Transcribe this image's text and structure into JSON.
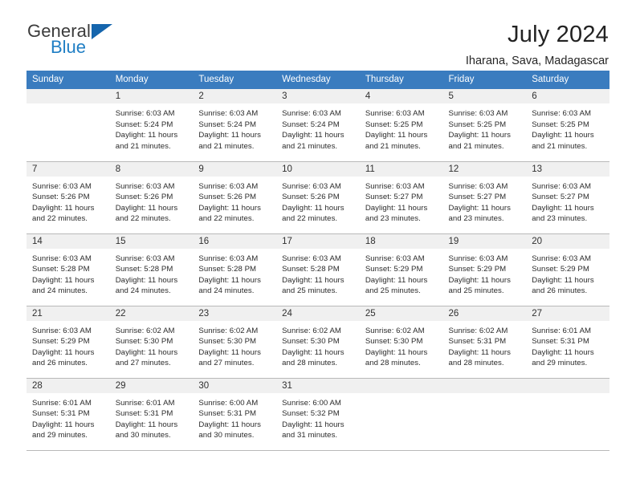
{
  "brand": {
    "name_part1": "General",
    "name_part2": "Blue",
    "logo_icon": "triangle-flag-icon",
    "accent_color": "#1565ad",
    "blue_text_color": "#1f7ec4"
  },
  "header": {
    "title": "July 2024",
    "location": "Iharana, Sava, Madagascar"
  },
  "calendar": {
    "header_bg": "#3a7cbf",
    "daynum_bg": "#f0f0f0",
    "weekdays": [
      "Sunday",
      "Monday",
      "Tuesday",
      "Wednesday",
      "Thursday",
      "Friday",
      "Saturday"
    ],
    "weeks": [
      [
        {
          "day": "",
          "lines": []
        },
        {
          "day": "1",
          "lines": [
            "Sunrise: 6:03 AM",
            "Sunset: 5:24 PM",
            "Daylight: 11 hours",
            "and 21 minutes."
          ]
        },
        {
          "day": "2",
          "lines": [
            "Sunrise: 6:03 AM",
            "Sunset: 5:24 PM",
            "Daylight: 11 hours",
            "and 21 minutes."
          ]
        },
        {
          "day": "3",
          "lines": [
            "Sunrise: 6:03 AM",
            "Sunset: 5:24 PM",
            "Daylight: 11 hours",
            "and 21 minutes."
          ]
        },
        {
          "day": "4",
          "lines": [
            "Sunrise: 6:03 AM",
            "Sunset: 5:25 PM",
            "Daylight: 11 hours",
            "and 21 minutes."
          ]
        },
        {
          "day": "5",
          "lines": [
            "Sunrise: 6:03 AM",
            "Sunset: 5:25 PM",
            "Daylight: 11 hours",
            "and 21 minutes."
          ]
        },
        {
          "day": "6",
          "lines": [
            "Sunrise: 6:03 AM",
            "Sunset: 5:25 PM",
            "Daylight: 11 hours",
            "and 21 minutes."
          ]
        }
      ],
      [
        {
          "day": "7",
          "lines": [
            "Sunrise: 6:03 AM",
            "Sunset: 5:26 PM",
            "Daylight: 11 hours",
            "and 22 minutes."
          ]
        },
        {
          "day": "8",
          "lines": [
            "Sunrise: 6:03 AM",
            "Sunset: 5:26 PM",
            "Daylight: 11 hours",
            "and 22 minutes."
          ]
        },
        {
          "day": "9",
          "lines": [
            "Sunrise: 6:03 AM",
            "Sunset: 5:26 PM",
            "Daylight: 11 hours",
            "and 22 minutes."
          ]
        },
        {
          "day": "10",
          "lines": [
            "Sunrise: 6:03 AM",
            "Sunset: 5:26 PM",
            "Daylight: 11 hours",
            "and 22 minutes."
          ]
        },
        {
          "day": "11",
          "lines": [
            "Sunrise: 6:03 AM",
            "Sunset: 5:27 PM",
            "Daylight: 11 hours",
            "and 23 minutes."
          ]
        },
        {
          "day": "12",
          "lines": [
            "Sunrise: 6:03 AM",
            "Sunset: 5:27 PM",
            "Daylight: 11 hours",
            "and 23 minutes."
          ]
        },
        {
          "day": "13",
          "lines": [
            "Sunrise: 6:03 AM",
            "Sunset: 5:27 PM",
            "Daylight: 11 hours",
            "and 23 minutes."
          ]
        }
      ],
      [
        {
          "day": "14",
          "lines": [
            "Sunrise: 6:03 AM",
            "Sunset: 5:28 PM",
            "Daylight: 11 hours",
            "and 24 minutes."
          ]
        },
        {
          "day": "15",
          "lines": [
            "Sunrise: 6:03 AM",
            "Sunset: 5:28 PM",
            "Daylight: 11 hours",
            "and 24 minutes."
          ]
        },
        {
          "day": "16",
          "lines": [
            "Sunrise: 6:03 AM",
            "Sunset: 5:28 PM",
            "Daylight: 11 hours",
            "and 24 minutes."
          ]
        },
        {
          "day": "17",
          "lines": [
            "Sunrise: 6:03 AM",
            "Sunset: 5:28 PM",
            "Daylight: 11 hours",
            "and 25 minutes."
          ]
        },
        {
          "day": "18",
          "lines": [
            "Sunrise: 6:03 AM",
            "Sunset: 5:29 PM",
            "Daylight: 11 hours",
            "and 25 minutes."
          ]
        },
        {
          "day": "19",
          "lines": [
            "Sunrise: 6:03 AM",
            "Sunset: 5:29 PM",
            "Daylight: 11 hours",
            "and 25 minutes."
          ]
        },
        {
          "day": "20",
          "lines": [
            "Sunrise: 6:03 AM",
            "Sunset: 5:29 PM",
            "Daylight: 11 hours",
            "and 26 minutes."
          ]
        }
      ],
      [
        {
          "day": "21",
          "lines": [
            "Sunrise: 6:03 AM",
            "Sunset: 5:29 PM",
            "Daylight: 11 hours",
            "and 26 minutes."
          ]
        },
        {
          "day": "22",
          "lines": [
            "Sunrise: 6:02 AM",
            "Sunset: 5:30 PM",
            "Daylight: 11 hours",
            "and 27 minutes."
          ]
        },
        {
          "day": "23",
          "lines": [
            "Sunrise: 6:02 AM",
            "Sunset: 5:30 PM",
            "Daylight: 11 hours",
            "and 27 minutes."
          ]
        },
        {
          "day": "24",
          "lines": [
            "Sunrise: 6:02 AM",
            "Sunset: 5:30 PM",
            "Daylight: 11 hours",
            "and 28 minutes."
          ]
        },
        {
          "day": "25",
          "lines": [
            "Sunrise: 6:02 AM",
            "Sunset: 5:30 PM",
            "Daylight: 11 hours",
            "and 28 minutes."
          ]
        },
        {
          "day": "26",
          "lines": [
            "Sunrise: 6:02 AM",
            "Sunset: 5:31 PM",
            "Daylight: 11 hours",
            "and 28 minutes."
          ]
        },
        {
          "day": "27",
          "lines": [
            "Sunrise: 6:01 AM",
            "Sunset: 5:31 PM",
            "Daylight: 11 hours",
            "and 29 minutes."
          ]
        }
      ],
      [
        {
          "day": "28",
          "lines": [
            "Sunrise: 6:01 AM",
            "Sunset: 5:31 PM",
            "Daylight: 11 hours",
            "and 29 minutes."
          ]
        },
        {
          "day": "29",
          "lines": [
            "Sunrise: 6:01 AM",
            "Sunset: 5:31 PM",
            "Daylight: 11 hours",
            "and 30 minutes."
          ]
        },
        {
          "day": "30",
          "lines": [
            "Sunrise: 6:00 AM",
            "Sunset: 5:31 PM",
            "Daylight: 11 hours",
            "and 30 minutes."
          ]
        },
        {
          "day": "31",
          "lines": [
            "Sunrise: 6:00 AM",
            "Sunset: 5:32 PM",
            "Daylight: 11 hours",
            "and 31 minutes."
          ]
        },
        {
          "day": "",
          "lines": []
        },
        {
          "day": "",
          "lines": []
        },
        {
          "day": "",
          "lines": []
        }
      ]
    ]
  }
}
